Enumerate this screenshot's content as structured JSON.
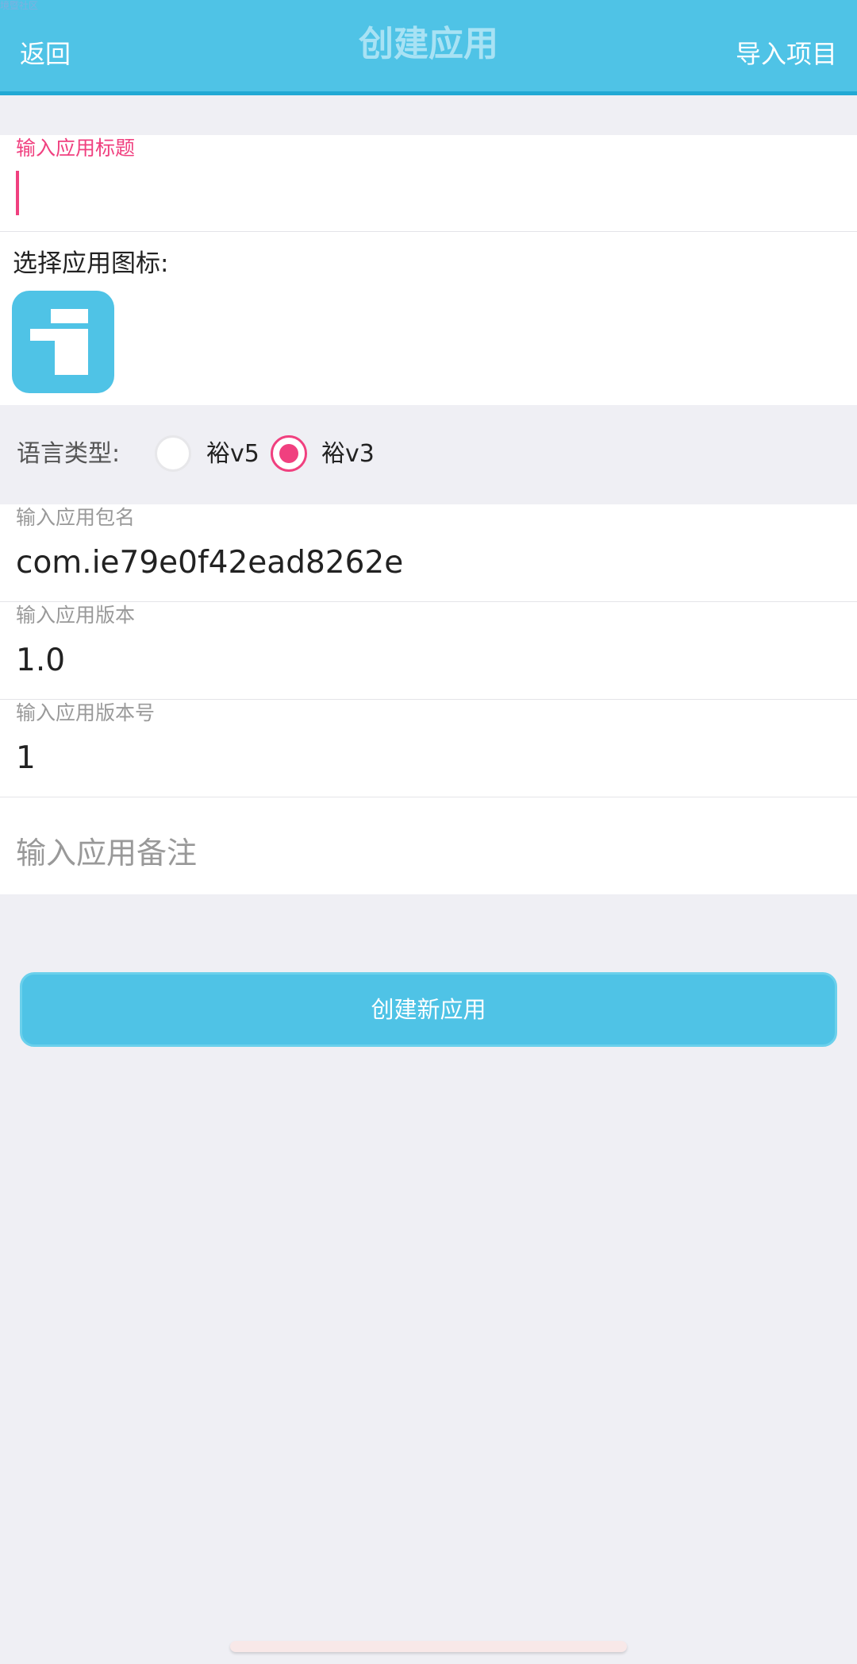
{
  "watermark": "境暨社区",
  "header": {
    "back_label": "返回",
    "title": "创建应用",
    "import_label": "导入项目"
  },
  "title_field": {
    "label": "输入应用标题",
    "value": ""
  },
  "icon_picker": {
    "label": "选择应用图标:",
    "icon": "app-i-icon"
  },
  "language": {
    "label": "语言类型:",
    "options": [
      {
        "label": "裕v5",
        "selected": false
      },
      {
        "label": "裕v3",
        "selected": true
      }
    ]
  },
  "fields": [
    {
      "label": "输入应用包名",
      "value": "com.ie79e0f42ead8262e"
    },
    {
      "label": "输入应用版本",
      "value": "1.0"
    },
    {
      "label": "输入应用版本号",
      "value": "1"
    }
  ],
  "remark": {
    "placeholder": "输入应用备注"
  },
  "create_button": "创建新应用",
  "colors": {
    "accent": "#4fc3e6",
    "highlight": "#f0407f",
    "background": "#efeff4"
  }
}
